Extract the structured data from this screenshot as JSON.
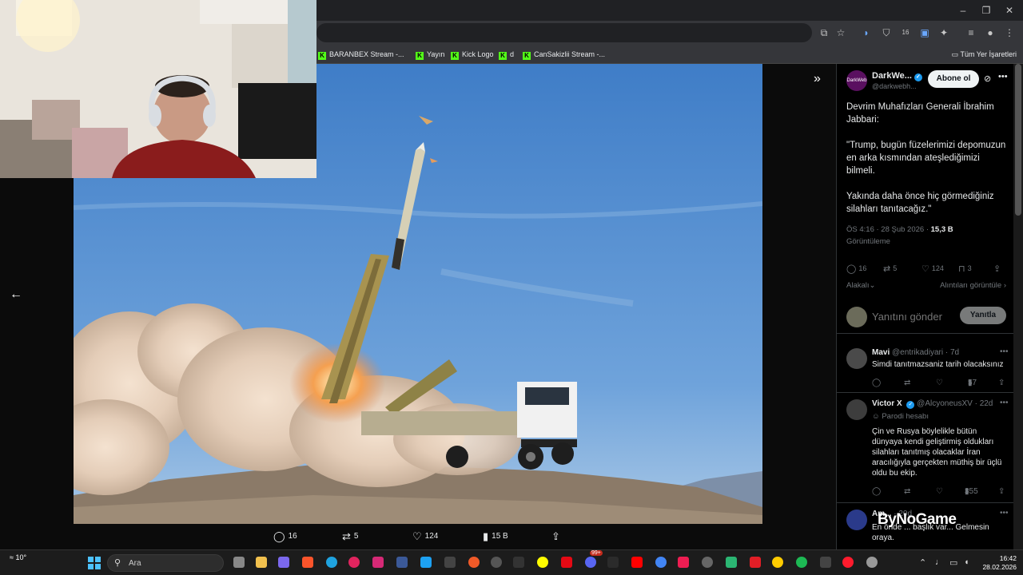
{
  "browser": {
    "window_controls": [
      "–",
      "❐",
      "✕"
    ],
    "bookmarks": [
      {
        "label": "BARANBEX Stream -..."
      },
      {
        "label": "Yayın"
      },
      {
        "label": "Kick Logo"
      },
      {
        "label": "d"
      },
      {
        "label": "CanSakizlii Stream -..."
      }
    ],
    "all_bookmarks_label": "Tüm Yer İşaretleri",
    "profile_badge": "16"
  },
  "media_bar": {
    "replies": "16",
    "reposts": "5",
    "likes": "124",
    "views": "15 B"
  },
  "tweet": {
    "author_name": "DarkWe...",
    "author_handle": "@darkwebh...",
    "avatar_text": "DarkWeb",
    "follow_label": "Abone ol",
    "text": "Devrim Muhafızları Generali İbrahim Jabbari:\n\n\"Trump, bugün füzelerimizi depomuzun en arka kısmından ateşlediğimizi bilmeli.\n\nYakında daha önce hiç görmediğiniz silahları tanıtacağız.\"",
    "time": "ÖS 4:16 · 28 Şub 2026 ·",
    "views_count": "15,3 B",
    "views_label": "Görüntüleme",
    "stats": {
      "replies": "16",
      "reposts": "5",
      "likes": "124",
      "bookmarks": "3"
    },
    "sort_label": "Alakalı",
    "quotes_link": "Alıntıları görüntüle"
  },
  "reply_box": {
    "placeholder": "Yanıtını gönder",
    "button_label": "Yanıtla"
  },
  "replies": [
    {
      "name": "Mavi",
      "handle": "@entrikadiyari · 7d",
      "text": "Simdi tanıtmazsaniz tarih olacaksınız",
      "likes": "",
      "views": "57"
    },
    {
      "name": "Victor X",
      "handle": "@AlcyoneusXV · 22d",
      "badge": "Parodi hesabı",
      "text": "Çin ve Rusya böylelikle bütün dünyaya kendi geliştirmiş oldukları silahları tanıtmış olacaklar İran aracılığıyla gerçekten müthiş bir üçlü oldu bu ekip.",
      "likes": "",
      "views": "355"
    },
    {
      "name": "Am...",
      "handle": "· 20d",
      "text": "En önde ... başlık var... Gelmesin oraya."
    }
  ],
  "watermark": "ByNoGame",
  "taskbar": {
    "weather": "10°",
    "search_label": "Ara",
    "clock_time": "16:42",
    "clock_date": "28.02.2026",
    "notification_badge": "99+"
  },
  "colors": {
    "accent": "#1d9bf0",
    "kick_green": "#53fc18",
    "sky_top": "#3f7dc7",
    "sky_bottom": "#8fb8e0"
  }
}
